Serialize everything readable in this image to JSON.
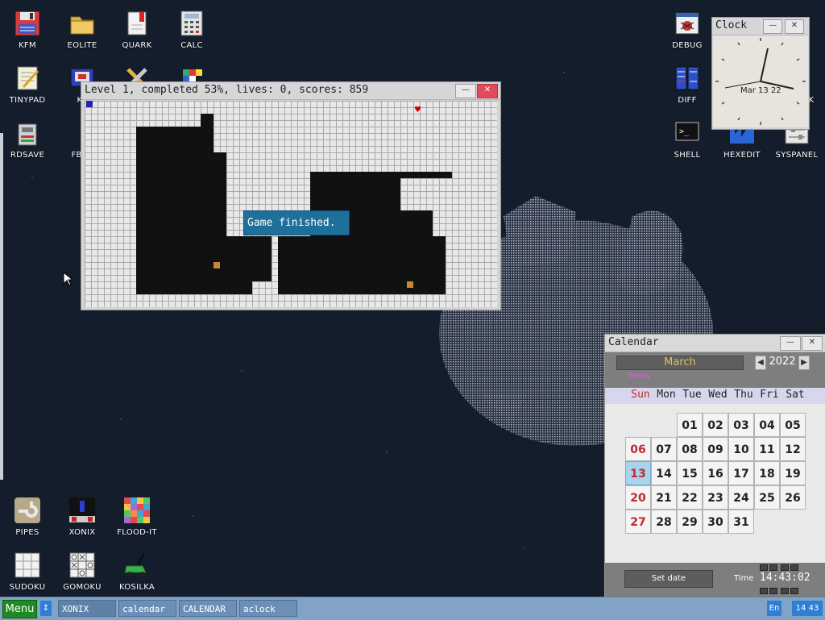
{
  "desktop": {
    "icons": [
      {
        "label": "KFM"
      },
      {
        "label": "EOLITE"
      },
      {
        "label": "QUARK"
      },
      {
        "label": "CALC"
      },
      {
        "label": "TINYPAD"
      },
      {
        "label": "KF"
      },
      {
        "label": "RDSAVE"
      },
      {
        "label": "FB2R"
      },
      {
        "label": "DEBUG"
      },
      {
        "label": "DIFF"
      },
      {
        "label": "K"
      },
      {
        "label": "SHELL"
      },
      {
        "label": "HEXEDIT"
      },
      {
        "label": "SYSPANEL"
      },
      {
        "label": "PIPES"
      },
      {
        "label": "XONIX"
      },
      {
        "label": "FLOOD-IT"
      },
      {
        "label": "SUDOKU"
      },
      {
        "label": "GOMOKU"
      },
      {
        "label": "KOSILKA"
      }
    ]
  },
  "xonix": {
    "title": "Level 1, completed 53%, lives: 0, scores: 859",
    "message": "Game finished.",
    "level": 1,
    "completed_percent": 53,
    "lives": 0,
    "scores": 859
  },
  "clock": {
    "title": "Clock",
    "date_text": "Mar 13 22"
  },
  "calendar": {
    "title": "Calendar",
    "month": "March",
    "year": "2022",
    "today_label": "Today",
    "weekdays": [
      "Sun",
      "Mon",
      "Tue",
      "Wed",
      "Thu",
      "Fri",
      "Sat"
    ],
    "days": [
      "01",
      "02",
      "03",
      "04",
      "05",
      "06",
      "07",
      "08",
      "09",
      "10",
      "11",
      "12",
      "13",
      "14",
      "15",
      "16",
      "17",
      "18",
      "19",
      "20",
      "21",
      "22",
      "23",
      "24",
      "25",
      "26",
      "27",
      "28",
      "29",
      "30",
      "31"
    ],
    "selected_day": "13",
    "set_date_label": "Set date",
    "time_label": "Time",
    "time_value": "14:43:02"
  },
  "taskbar": {
    "menu_label": "Menu",
    "swap_icon": "↕",
    "tasks": [
      {
        "label": "XONIX"
      },
      {
        "label": "calendar"
      },
      {
        "label": "CALENDAR"
      },
      {
        "label": "aclock"
      }
    ],
    "language": "En",
    "clock": "14 43"
  },
  "colors": {
    "accent_blue": "#2f7fd6",
    "menu_green": "#1e8a24",
    "sunday_red": "#c2282e",
    "close_red": "#e24c5a",
    "desktop_bg": "#131d2c"
  }
}
